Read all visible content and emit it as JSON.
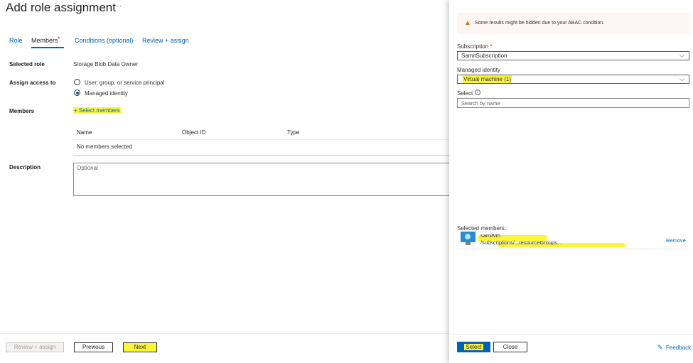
{
  "page": {
    "title": "Add role assignment",
    "more": "···"
  },
  "tabs": [
    {
      "label": "Role"
    },
    {
      "label": "Members",
      "required_marker": "*"
    },
    {
      "label": "Conditions (optional)"
    },
    {
      "label": "Review + assign"
    }
  ],
  "form": {
    "selected_role_label": "Selected role",
    "selected_role_value": "Storage Blob Data Owner",
    "assign_access_label": "Assign access to",
    "assign_options": [
      "User, group, or service principal",
      "Managed identity"
    ],
    "members_label": "Members",
    "select_members_link": "+ Select members",
    "table_headers": [
      "Name",
      "Object ID",
      "Type"
    ],
    "no_members": "No members selected",
    "description_label": "Description",
    "description_placeholder": "Optional"
  },
  "footer": {
    "review_assign": "Review + assign",
    "previous": "Previous",
    "next": "Next"
  },
  "panel": {
    "warning": "Some results might be hidden due to your ABAC condition.",
    "subscription_label": "Subscription",
    "required_marker": "*",
    "subscription_value": "SamitSubscription",
    "managed_identity_label": "Managed identity",
    "managed_identity_value": "Virtual machine (1)",
    "select_label": "Select",
    "info_glyph": "i",
    "search_placeholder": "Search by name",
    "selected_members_label": "Selected members:",
    "member_name": "samitvm",
    "member_path": "/subscriptions/...resourceGroups...",
    "remove": "Remove",
    "select_button": "Select",
    "close_button": "Close",
    "feedback": "Feedback"
  },
  "colors": {
    "accent": "#0064b4",
    "highlight": "#fcf63a",
    "required": "#c50f1f",
    "warning_bg": "#fdf6f3"
  }
}
